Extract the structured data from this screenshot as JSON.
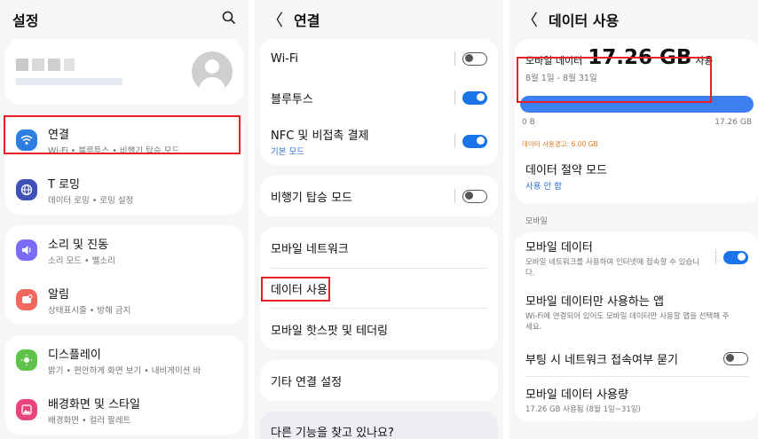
{
  "settings": {
    "header_title": "설정",
    "items": [
      {
        "title": "연결",
        "sub": "Wi-Fi • 블루투스 • 비행기 탑승 모드",
        "color": "#2e7de0"
      },
      {
        "title": "T 로밍",
        "sub": "데이터 로밍 • 로밍 설정",
        "color": "#3f51b5"
      },
      {
        "title": "소리 및 진동",
        "sub": "소리 모드 • 벨소리",
        "color": "#7b6cf6"
      },
      {
        "title": "알림",
        "sub": "상태표시줄 • 방해 금지",
        "color": "#f0675d"
      },
      {
        "title": "디스플레이",
        "sub": "밝기 • 편안하게 화면 보기 • 내비게이션 바",
        "color": "#5fc24a"
      },
      {
        "title": "배경화면 및 스타일",
        "sub": "배경화면 • 컬러 팔레트",
        "color": "#e8457a"
      }
    ]
  },
  "connections": {
    "header_title": "연결",
    "wifi": "Wi-Fi",
    "bluetooth": "블루투스",
    "nfc_title": "NFC 및 비접촉 결제",
    "nfc_sub": "기본 모드",
    "airplane": "비행기 탑승 모드",
    "mobile_network": "모바일 네트워크",
    "data_usage": "데이터 사용",
    "hotspot": "모바일 핫스팟 및 테더링",
    "other": "기타 연결 설정",
    "looking": "다른 기능을 찾고 있나요?",
    "toggles": {
      "wifi": false,
      "bluetooth": true,
      "nfc": true,
      "airplane": false
    }
  },
  "data_usage": {
    "header_title": "데이터 사용",
    "mobile_label": "모바일 데이터",
    "amount": "17.26 GB",
    "used_suffix": "사용",
    "period": "8월 1일 - 8월 31일",
    "usage_fraction": 1.0,
    "bar_min": "0 B",
    "bar_max": "17.26 GB",
    "warning": "데이터 사용경고: 6.00 GB",
    "saver_title": "데이터 절약 모드",
    "saver_sub": "사용 안 함",
    "section_mobile": "모바일",
    "mobile_data_title": "모바일 데이터",
    "mobile_data_sub": "모바일 네트워크를 사용하여 인터넷에 접속할 수 있습니다.",
    "mobile_only_title": "모바일 데이터만 사용하는 앱",
    "mobile_only_sub": "Wi-Fi에 연결되어 있어도 모바일 데이터만 사용할 앱을 선택해 주세요.",
    "boot_title": "부팅 시 네트워크 접속여부 묻기",
    "usage_title": "모바일 데이터 사용량",
    "usage_sub": "17.26 GB 사용됨 (8월 1일~31일)",
    "toggles": {
      "mobile_data": true,
      "boot": false
    }
  },
  "colors": {
    "accent": "#1a73e8",
    "highlight": "#e8202a",
    "warning": "#e07a1f",
    "bar": "#3d7ff0"
  }
}
